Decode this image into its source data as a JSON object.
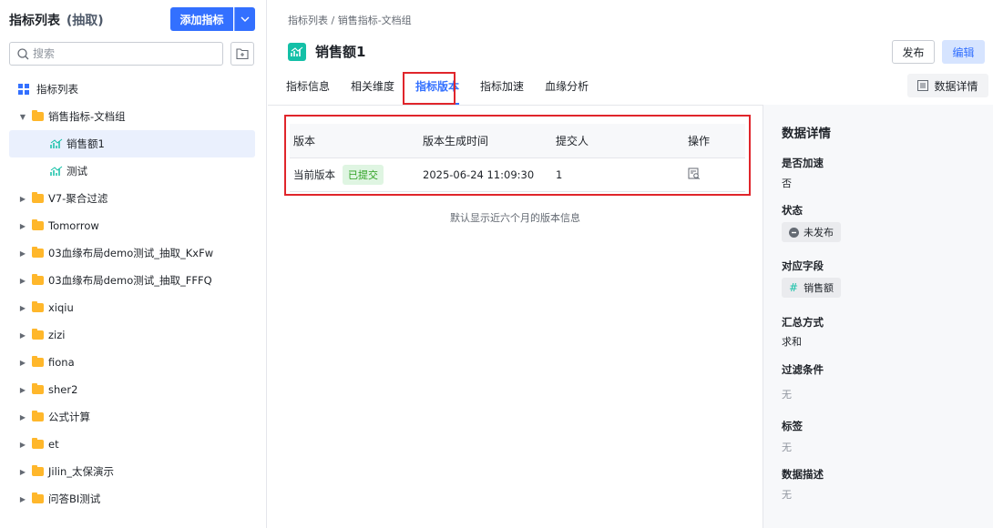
{
  "sidebar": {
    "title": "指标列表",
    "title_suffix": "(抽取)",
    "add_button": "添加指标",
    "search_placeholder": "搜索",
    "root_label": "指标列表",
    "tree": [
      {
        "label": "销售指标-文档组",
        "type": "folder",
        "expanded": true,
        "level": 0
      },
      {
        "label": "销售额1",
        "type": "metric",
        "level": 1,
        "selected": true
      },
      {
        "label": "测试",
        "type": "metric",
        "level": 1
      },
      {
        "label": "V7-聚合过滤",
        "type": "folder",
        "level": 0
      },
      {
        "label": "Tomorrow",
        "type": "folder",
        "level": 0
      },
      {
        "label": "03血缘布局demo测试_抽取_KxFw",
        "type": "folder",
        "level": 0
      },
      {
        "label": "03血缘布局demo测试_抽取_FFFQ",
        "type": "folder",
        "level": 0
      },
      {
        "label": "xiqiu",
        "type": "folder",
        "level": 0
      },
      {
        "label": "zizi",
        "type": "folder",
        "level": 0
      },
      {
        "label": "fiona",
        "type": "folder",
        "level": 0
      },
      {
        "label": "sher2",
        "type": "folder",
        "level": 0
      },
      {
        "label": "公式计算",
        "type": "folder",
        "level": 0
      },
      {
        "label": "et",
        "type": "folder",
        "level": 0
      },
      {
        "label": "Jilin_太保演示",
        "type": "folder",
        "level": 0
      },
      {
        "label": "问答BI测试",
        "type": "folder",
        "level": 0
      }
    ]
  },
  "main": {
    "breadcrumb": "指标列表 / 销售指标-文档组",
    "title": "销售额1",
    "publish_button": "发布",
    "edit_button": "编辑",
    "data_detail_button": "数据详情",
    "tabs": [
      {
        "label": "指标信息",
        "active": false
      },
      {
        "label": "相关维度",
        "active": false
      },
      {
        "label": "指标版本",
        "active": true
      },
      {
        "label": "指标加速",
        "active": false
      },
      {
        "label": "血缘分析",
        "active": false
      }
    ],
    "table": {
      "headers": [
        "版本",
        "版本生成时间",
        "提交人",
        "操作"
      ],
      "rows": [
        {
          "version": "当前版本",
          "status": "已提交",
          "time": "2025-06-24 11:09:30",
          "submitter": "1"
        }
      ]
    },
    "note": "默认显示近六个月的版本信息"
  },
  "detail": {
    "title": "数据详情",
    "accelerated_label": "是否加速",
    "accelerated_value": "否",
    "status_label": "状态",
    "status_value": "未发布",
    "field_label": "对应字段",
    "field_value": "销售额",
    "agg_label": "汇总方式",
    "agg_value": "求和",
    "filter_label": "过滤条件",
    "filter_value": "无",
    "tag_label": "标签",
    "tag_value": "无",
    "desc_label": "数据描述",
    "desc_value": "无"
  },
  "colors": {
    "primary": "#3370ff",
    "highlight": "#e0252b",
    "success": "#2ea121",
    "folder": "#ffb72b",
    "metric": "#14c0a7"
  }
}
